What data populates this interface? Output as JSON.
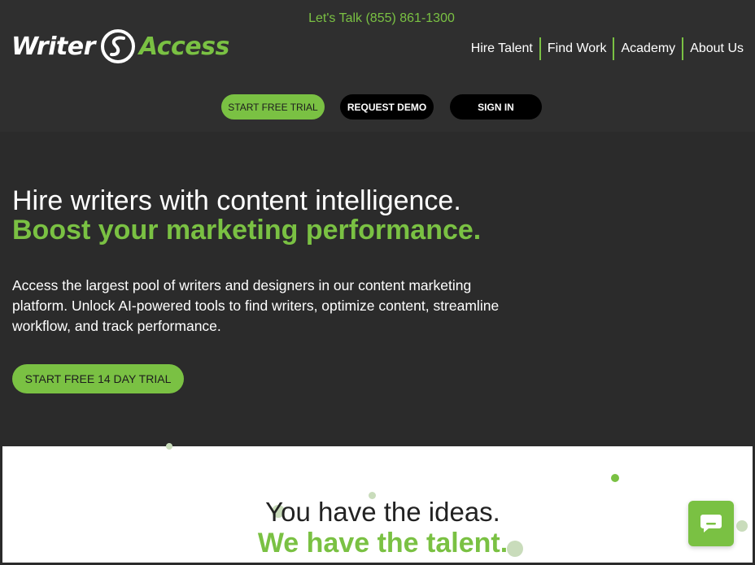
{
  "header": {
    "phone": "Let's Talk (855) 861-1300",
    "logo": {
      "word1": "Writer",
      "word2": "Access"
    },
    "nav": [
      "Hire Talent",
      "Find Work",
      "Academy",
      "About Us"
    ],
    "buttons": {
      "trial": "START FREE TRIAL",
      "demo": "REQUEST DEMO",
      "signin": "SIGN IN"
    }
  },
  "hero": {
    "headline": "Hire writers with content intelligence.",
    "subheadline": "Boost your marketing performance.",
    "lead": "Access the largest pool of writers and designers in our content marketing platform. Unlock AI-powered tools to find writers, optimize content, streamline workflow, and track performance.",
    "cta": "START FREE 14 DAY TRIAL"
  },
  "section": {
    "line1": "You have the ideas.",
    "line2": "We have the talent."
  },
  "colors": {
    "accent": "#7ac143",
    "dark": "#2b2b2b"
  },
  "icons": {
    "chat": "chat-bubble-icon"
  }
}
